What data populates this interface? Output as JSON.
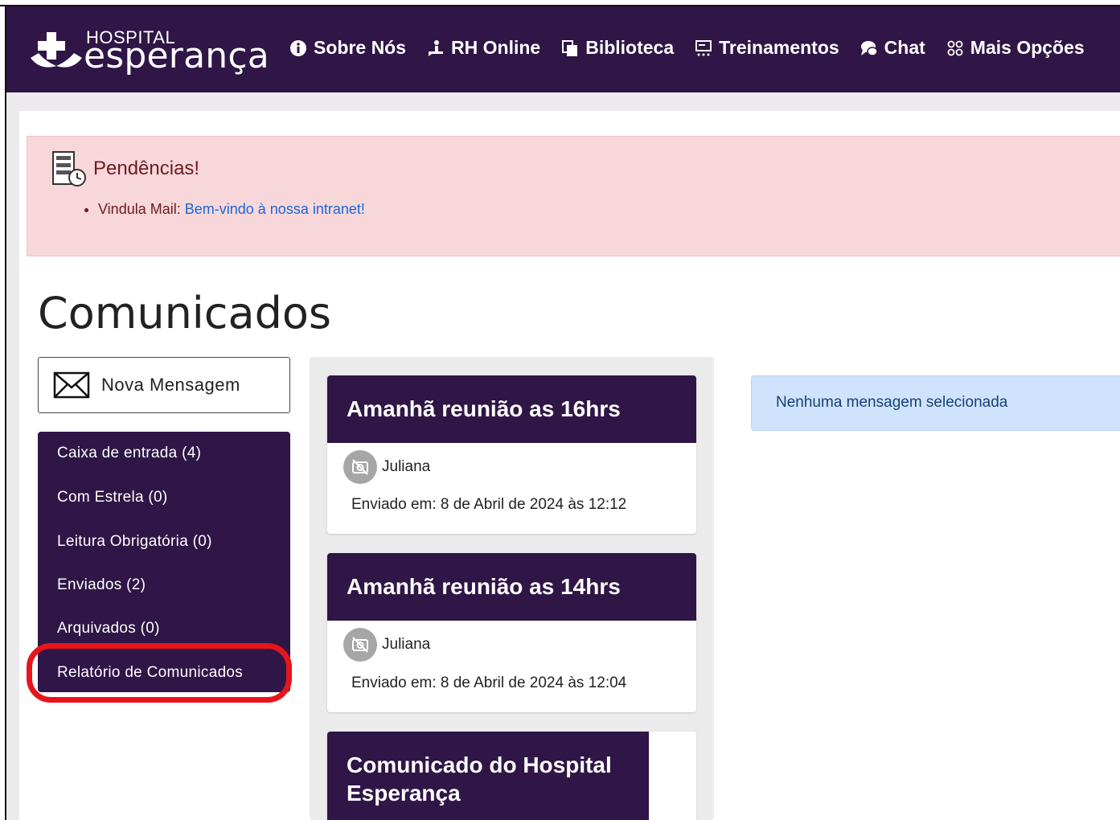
{
  "brand": {
    "small": "HOSPITAL",
    "big": "esperança"
  },
  "nav": {
    "items": [
      {
        "label": "Sobre Nós",
        "icon": "info-icon"
      },
      {
        "label": "RH Online",
        "icon": "person-hand-icon"
      },
      {
        "label": "Biblioteca",
        "icon": "copy-icon"
      },
      {
        "label": "Treinamentos",
        "icon": "presentation-icon"
      },
      {
        "label": "Chat",
        "icon": "chat-icon"
      },
      {
        "label": "Mais Opções",
        "icon": "grid-icon"
      }
    ]
  },
  "alert": {
    "title": "Pendências!",
    "item_prefix": "Vindula Mail:",
    "item_link": "Bem-vindo à nossa intranet!"
  },
  "page_title": "Comunicados",
  "compose": {
    "label": "Nova Mensagem"
  },
  "folders": [
    {
      "label": "Caixa de entrada (4)"
    },
    {
      "label": "Com Estrela (0)"
    },
    {
      "label": "Leitura Obrigatória (0)"
    },
    {
      "label": "Enviados (2)"
    },
    {
      "label": "Arquivados (0)"
    },
    {
      "label": "Relatório de Comunicados"
    }
  ],
  "messages": [
    {
      "title": "Amanhã reunião as 16hrs",
      "sender": "Juliana",
      "date": "Enviado em: 8 de Abril de 2024 às 12:12"
    },
    {
      "title": "Amanhã reunião as 14hrs",
      "sender": "Juliana",
      "date": "Enviado em: 8 de Abril de 2024 às 12:04"
    },
    {
      "title": "Comunicado do Hospital Esperança"
    }
  ],
  "empty_state": "Nenhuma mensagem selecionada",
  "colors": {
    "primary": "#2f1646",
    "alert_bg": "#f7d7da",
    "alert_text": "#6e1a22",
    "link": "#1c66d6",
    "info_bg": "#cfe3fc",
    "highlight": "#e8141c"
  }
}
